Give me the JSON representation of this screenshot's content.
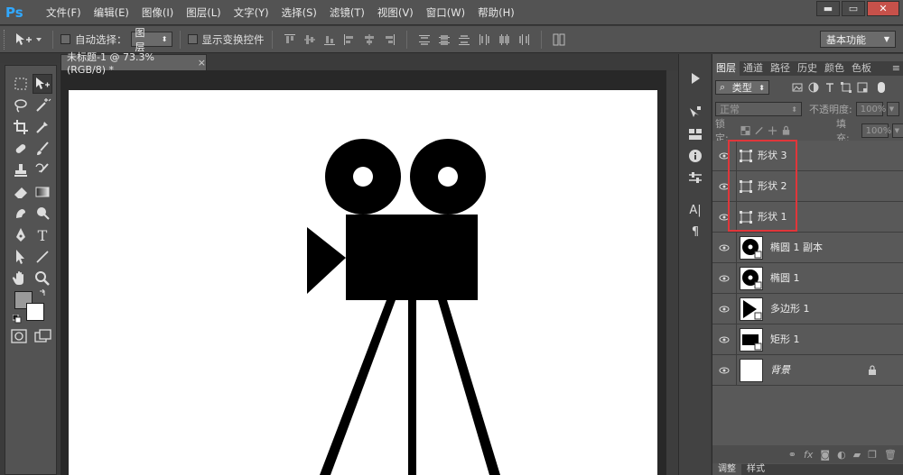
{
  "app": {
    "logo": "Ps"
  },
  "menu": [
    "文件(F)",
    "编辑(E)",
    "图像(I)",
    "图层(L)",
    "文字(Y)",
    "选择(S)",
    "滤镜(T)",
    "视图(V)",
    "窗口(W)",
    "帮助(H)"
  ],
  "window_controls": {
    "minimize": "▬",
    "maximize": "▭",
    "close": "✕"
  },
  "options": {
    "auto_select_label": "自动选择：",
    "auto_select_value": "图层",
    "show_transform_label": "显示变换控件",
    "workspace": "基本功能"
  },
  "document": {
    "tab_title": "未标题-1 @ 73.3%(RGB/8) *",
    "close": "×"
  },
  "panel": {
    "tabs": [
      "图层",
      "通道",
      "路径",
      "历史",
      "颜色",
      "色板"
    ],
    "filter_kind": "类型",
    "blend_mode": "正常",
    "opacity_label": "不透明度:",
    "opacity_value": "100%",
    "lock_label": "锁定:",
    "fill_label": "填充:",
    "fill_value": "100%",
    "bottom_tabs": [
      "调整",
      "样式"
    ]
  },
  "layers": [
    {
      "name": "形状 3",
      "kind": "shape"
    },
    {
      "name": "形状 2",
      "kind": "shape"
    },
    {
      "name": "形状 1",
      "kind": "shape"
    },
    {
      "name": "椭圆 1 副本",
      "kind": "ellipse"
    },
    {
      "name": "椭圆 1",
      "kind": "ellipse"
    },
    {
      "name": "多边形 1",
      "kind": "polygon"
    },
    {
      "name": "矩形 1",
      "kind": "rect"
    },
    {
      "name": "背景",
      "kind": "background"
    }
  ],
  "colors": {
    "accent": "#31a8ff",
    "highlight": "#e0363a",
    "canvas": "#ffffff"
  }
}
